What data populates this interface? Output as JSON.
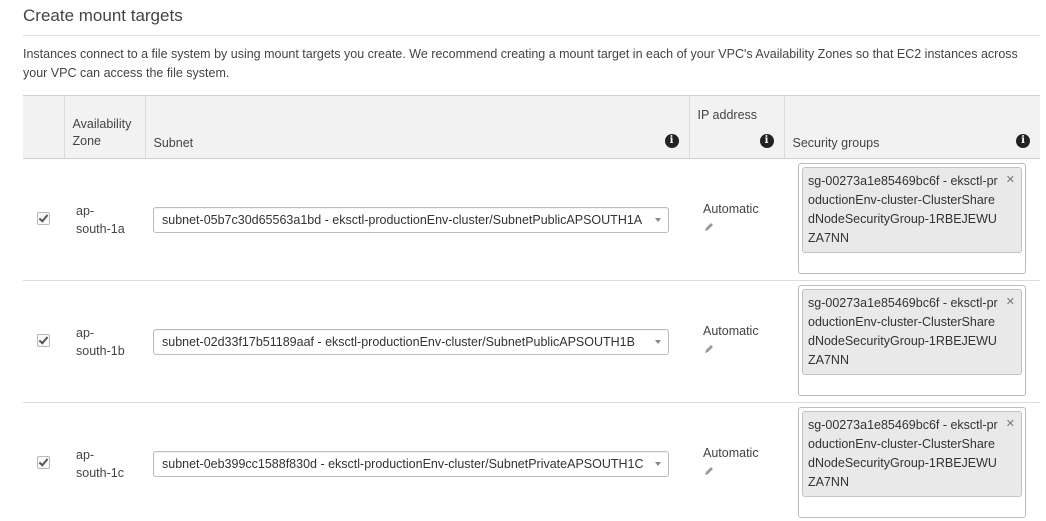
{
  "title": "Create mount targets",
  "description": "Instances connect to a file system by using mount targets you create. We recommend creating a mount target in each of your VPC's Availability Zones so that EC2 instances across your VPC can access the file system.",
  "table": {
    "headers": {
      "az": "Availability Zone",
      "subnet": "Subnet",
      "ip": "IP address",
      "sg": "Security groups"
    },
    "rows": [
      {
        "az": "ap-south-1a",
        "subnet": "subnet-05b7c30d65563a1bd - eksctl-productionEnv-cluster/SubnetPublicAPSOUTH1A",
        "ip": "Automatic",
        "sg": "sg-00273a1e85469bc6f - eksctl-productionEnv-cluster-ClusterSharedNodeSecurityGroup-1RBEJEWUZA7NN"
      },
      {
        "az": "ap-south-1b",
        "subnet": "subnet-02d33f17b51189aaf - eksctl-productionEnv-cluster/SubnetPublicAPSOUTH1B",
        "ip": "Automatic",
        "sg": "sg-00273a1e85469bc6f - eksctl-productionEnv-cluster-ClusterSharedNodeSecurityGroup-1RBEJEWUZA7NN"
      },
      {
        "az": "ap-south-1c",
        "subnet": "subnet-0eb399cc1588f830d - eksctl-productionEnv-cluster/SubnetPrivateAPSOUTH1C",
        "ip": "Automatic",
        "sg": "sg-00273a1e85469bc6f - eksctl-productionEnv-cluster-ClusterSharedNodeSecurityGroup-1RBEJEWUZA7NN"
      }
    ]
  },
  "icons": {
    "info": "info-icon",
    "edit": "pencil-icon",
    "remove": "close-icon",
    "dropdown": "chevron-down-icon"
  }
}
